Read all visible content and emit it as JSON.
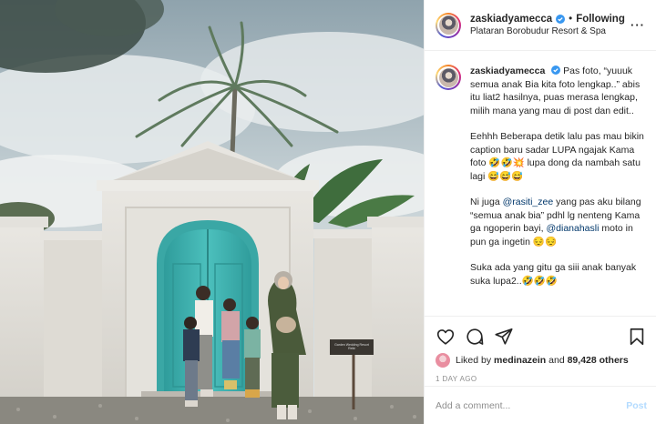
{
  "post": {
    "username": "zaskiadyamecca",
    "follow_status": "Following",
    "separator": "•",
    "location": "Plataran Borobudur Resort & Spa",
    "more_icon": "more-horizontal-icon",
    "more_label": "···"
  },
  "photo": {
    "sign_text": "Garden Wedding Resort Reiki"
  },
  "caption": {
    "username": "zaskiadyamecca",
    "p1": "Pas foto, “yuuuk semua anak Bia kita foto lengkap..” abis itu liat2 hasilnya, puas merasa lengkap, milih mana yang mau di post dan edit..",
    "p2": "Eehhh Beberapa detik lalu pas mau bikin caption baru sadar LUPA ngajak Kama foto 🤣🤣💥 lupa dong da nambah satu lagi 😅😅😅",
    "p3_a": "Ni juga ",
    "p3_mention1": "@rasiti_zee",
    "p3_b": " yang pas aku bilang “semua anak bia” pdhl lg nenteng Kama ga ngoperin bayi, ",
    "p3_mention2": "@dianahasli",
    "p3_c": " moto in pun ga ingetin 😔😔",
    "p4": "Suka ada yang gitu ga siii anak banyak suka lupa2..🤣🤣🤣"
  },
  "actions": {
    "like_icon": "heart-icon",
    "comment_icon": "comment-icon",
    "share_icon": "share-icon",
    "save_icon": "bookmark-icon"
  },
  "likes": {
    "prefix": "Liked by ",
    "user": "medinazein",
    "middle": " and ",
    "count": "89,428 others"
  },
  "timestamp": "1 DAY AGO",
  "comment_box": {
    "placeholder": "Add a comment...",
    "post_label": "Post"
  },
  "colors": {
    "link": "#00376b",
    "muted": "#8e8e8e",
    "post_disabled": "#b3dbff",
    "verified": "#3897f0",
    "door": "#3fb3b1"
  }
}
